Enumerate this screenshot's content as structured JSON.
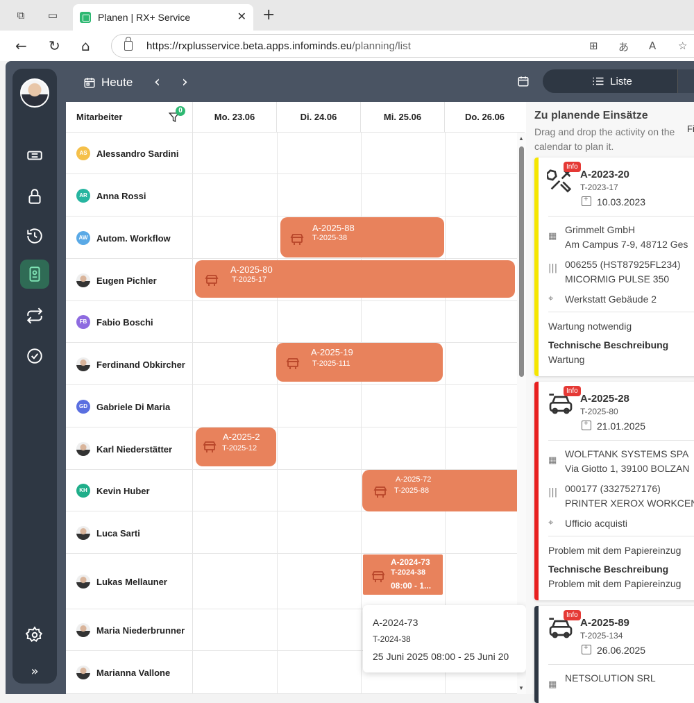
{
  "browser": {
    "tab_title": "Planen | RX+ Service",
    "url_host": "https://rxplusservice.beta.apps.infominds.eu",
    "url_path": "/planning/list",
    "close_glyph": "✕",
    "new_tab_glyph": "+"
  },
  "toolbar": {
    "today_label": "Heute",
    "view_label": "Liste"
  },
  "grid": {
    "employee_header": "Mitarbeiter",
    "filter_count": "0",
    "days": [
      "Mo. 23.06",
      "Di. 24.06",
      "Mi. 25.06",
      "Do. 26.06"
    ]
  },
  "employees": [
    {
      "name": "Alessandro Sardini",
      "initials": "AS",
      "color": "#f5c04a"
    },
    {
      "name": "Anna Rossi",
      "initials": "AR",
      "color": "#26b5a0"
    },
    {
      "name": "Autom. Workflow",
      "initials": "AW",
      "color": "#5aa9e6"
    },
    {
      "name": "Eugen Pichler",
      "initials": "",
      "color": ""
    },
    {
      "name": "Fabio Boschi",
      "initials": "FB",
      "color": "#8e6be0"
    },
    {
      "name": "Ferdinand Obkircher",
      "initials": "",
      "color": ""
    },
    {
      "name": "Gabriele Di Maria",
      "initials": "GD",
      "color": "#5a6fe0"
    },
    {
      "name": "Karl Niederstätter",
      "initials": "",
      "color": ""
    },
    {
      "name": "Kevin Huber",
      "initials": "KH",
      "color": "#1fae8a"
    },
    {
      "name": "Luca Sarti",
      "initials": "",
      "color": ""
    },
    {
      "name": "Lukas Mellauner",
      "initials": "",
      "color": ""
    },
    {
      "name": "Maria Niederbrunner",
      "initials": "",
      "color": ""
    },
    {
      "name": "Marianna Vallone",
      "initials": "",
      "color": ""
    }
  ],
  "blocks": [
    {
      "code": "A-2025-88",
      "task": "T-2025-38"
    },
    {
      "code": "A-2025-80",
      "task": "T-2025-17"
    },
    {
      "code": "A-2025-19",
      "task": "T-2025-111"
    },
    {
      "code": "A-2025-2",
      "task": "T-2025-12"
    },
    {
      "code": "A-2025-72",
      "task": "T-2025-88"
    },
    {
      "code": "A-2024-73",
      "task": "T-2024-38",
      "time": "08:00 - 1..."
    }
  ],
  "tooltip": {
    "code": "A-2024-73",
    "task": "T-2024-38",
    "range": "25 Juni 2025 08:00 - 25 Juni 20"
  },
  "panel": {
    "title": "Zu planende Einsätze",
    "hint": "Drag and drop the activity on the calendar to plan it.",
    "filter_partial": "Fi",
    "cards": [
      {
        "badge": "Info",
        "code": "A-2023-20",
        "task": "T-2023-17",
        "date": "10.03.2023",
        "company": "Grimmelt GmbH",
        "address": "Am Campus 7-9, 48712 Ges",
        "serial": "006255 (HST87925FL234)",
        "device": "MICORMIG PULSE 350",
        "location": "Werkstatt Gebäude 2",
        "note": "Wartung notwendig",
        "desc_label": "Technische Beschreibung",
        "desc": "Wartung",
        "color": "#f5e600"
      },
      {
        "badge": "Info",
        "code": "A-2025-28",
        "task": "T-2025-80",
        "date": "21.01.2025",
        "company": "WOLFTANK SYSTEMS SPA",
        "address": "Via Giotto 1, 39100 BOLZAN",
        "serial": "000177 (3327527176)",
        "device": "PRINTER XEROX WORKCENT",
        "location": "Ufficio acquisti",
        "note": "Problem mit dem Papiereinzug",
        "desc_label": "Technische Beschreibung",
        "desc": "Problem mit dem Papiereinzug",
        "color": "#e82020"
      },
      {
        "badge": "Info",
        "code": "A-2025-89",
        "task": "T-2025-134",
        "date": "26.06.2025",
        "company": "NETSOLUTION SRL",
        "color": "#2e3743"
      }
    ]
  }
}
